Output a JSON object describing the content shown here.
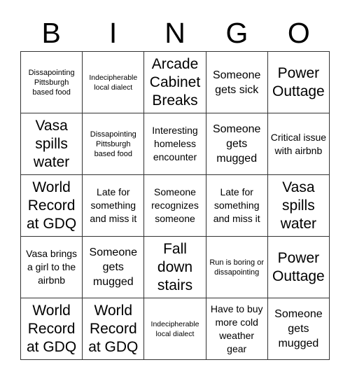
{
  "header": {
    "letters": [
      "B",
      "I",
      "N",
      "G",
      "O"
    ]
  },
  "board": {
    "rows": [
      [
        {
          "text": "Dissapointing Pittsburgh based food",
          "size": "s"
        },
        {
          "text": "Indecipherable local dialect",
          "size": "xs"
        },
        {
          "text": "Arcade Cabinet Breaks",
          "size": "xl"
        },
        {
          "text": "Someone gets sick",
          "size": "l"
        },
        {
          "text": "Power Outtage",
          "size": "xl"
        }
      ],
      [
        {
          "text": "Vasa spills water",
          "size": "xl"
        },
        {
          "text": "Dissapointing Pittsburgh based food",
          "size": "s"
        },
        {
          "text": "Interesting homeless encounter",
          "size": "m"
        },
        {
          "text": "Someone gets mugged",
          "size": "l"
        },
        {
          "text": "Critical issue with airbnb",
          "size": "m"
        }
      ],
      [
        {
          "text": "World Record at GDQ",
          "size": "xl"
        },
        {
          "text": "Late for something and miss it",
          "size": "m"
        },
        {
          "text": "Someone recognizes someone",
          "size": "m"
        },
        {
          "text": "Late for something and miss it",
          "size": "m"
        },
        {
          "text": "Vasa spills water",
          "size": "xl"
        }
      ],
      [
        {
          "text": "Vasa brings a girl to the airbnb",
          "size": "m"
        },
        {
          "text": "Someone gets mugged",
          "size": "l"
        },
        {
          "text": "Fall down stairs",
          "size": "xl"
        },
        {
          "text": "Run is boring or dissapointing",
          "size": "s"
        },
        {
          "text": "Power Outtage",
          "size": "xl"
        }
      ],
      [
        {
          "text": "World Record at GDQ",
          "size": "xl"
        },
        {
          "text": "World Record at GDQ",
          "size": "xl"
        },
        {
          "text": "Indecipherable local dialect",
          "size": "xs"
        },
        {
          "text": "Have to buy more cold weather gear",
          "size": "m"
        },
        {
          "text": "Someone gets mugged",
          "size": "l"
        }
      ]
    ]
  }
}
